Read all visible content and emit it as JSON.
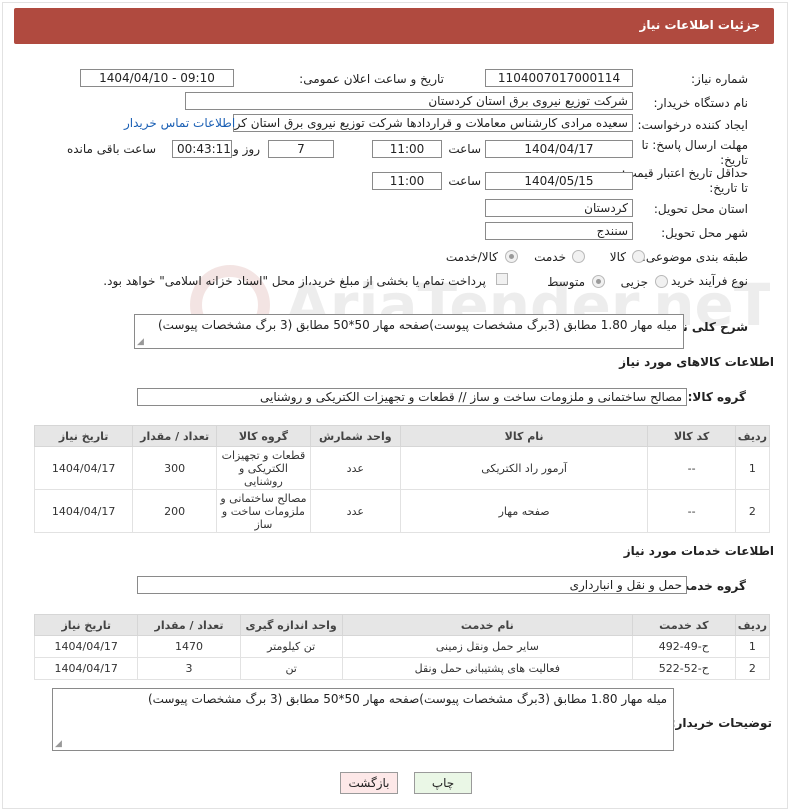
{
  "header": {
    "title": "جزئیات اطلاعات نیاز"
  },
  "fields": {
    "need_number_label": "شماره نیاز:",
    "need_number": "1104007017000114",
    "announce_label": "تاریخ و ساعت اعلان عمومی:",
    "announce_value": "1404/04/10 - 09:10",
    "buyer_org_label": "نام دستگاه خریدار:",
    "buyer_org": "شرکت توزیع نیروی برق استان کردستان",
    "requester_label": "ایجاد کننده درخواست:",
    "requester": "سعیده مرادی کارشناس معاملات و قراردادها شرکت توزیع نیروی برق استان کردستان",
    "contact_link": "اطلاعات تماس خریدار",
    "reply_deadline_label": "مهلت ارسال پاسخ: تا تاریخ:",
    "reply_date": "1404/04/17",
    "time_label": "ساعت",
    "reply_time": "11:00",
    "days_value": "7",
    "days_label": "روز و",
    "remaining_time": "00:43:11",
    "remaining_label": "ساعت باقی مانده",
    "price_validity_label": "حداقل تاریخ اعتبار قیمت: تا تاریخ:",
    "price_date": "1404/05/15",
    "price_time": "11:00",
    "province_label": "استان محل تحویل:",
    "province": "کردستان",
    "city_label": "شهر محل تحویل:",
    "city": "سنندج",
    "category_label": "طبقه بندی موضوعی:",
    "category_options": [
      "کالا",
      "خدمت",
      "کالا/خدمت"
    ],
    "process_label": "نوع فرآیند خرید :",
    "process_options": [
      "جزیی",
      "متوسط"
    ],
    "payment_note": "پرداخت تمام یا بخشی از مبلغ خرید،از محل \"اسناد خزانه اسلامی\" خواهد بود.",
    "description_label": "شرح کلی نیاز:",
    "description": "میله مهار 1.80 مطابق (3برگ مشخصات پیوست)صفحه مهار 50*50 مطابق (3 برگ مشخصات پیوست)"
  },
  "goods": {
    "section_title": "اطلاعات کالاهای مورد نیاز",
    "group_label": "گروه کالا:",
    "group_value": "مصالح ساختمانی و ملزومات ساخت و ساز // قطعات و تجهیزات الکتریکی و روشنایی",
    "columns": [
      "ردیف",
      "کد کالا",
      "نام کالا",
      "واحد شمارش",
      "گروه کالا",
      "تعداد / مقدار",
      "تاریخ نیاز"
    ],
    "rows": [
      [
        "1",
        "--",
        "آرمور راد الکتریکی",
        "عدد",
        "قطعات و تجهیزات الکتریکی و روشنایی",
        "300",
        "1404/04/17"
      ],
      [
        "2",
        "--",
        "صفحه مهار",
        "عدد",
        "مصالح ساختمانی و ملزومات ساخت و ساز",
        "200",
        "1404/04/17"
      ]
    ]
  },
  "services": {
    "section_title": "اطلاعات خدمات مورد نیاز",
    "group_label": "گروه خدمت:",
    "group_value": "حمل و نقل و انبارداری",
    "columns": [
      "ردیف",
      "کد خدمت",
      "نام خدمت",
      "واحد اندازه گیری",
      "تعداد / مقدار",
      "تاریخ نیاز"
    ],
    "rows": [
      [
        "1",
        "ح-49-492",
        "سایر حمل ونقل زمینی",
        "تن کیلومتر",
        "1470",
        "1404/04/17"
      ],
      [
        "2",
        "ح-52-522",
        "فعالیت های پشتیبانی حمل ونقل",
        "تن",
        "3",
        "1404/04/17"
      ]
    ]
  },
  "buyer_notes": {
    "label": "توضیحات خریدار:",
    "value": "میله مهار 1.80 مطابق (3برگ مشخصات پیوست)صفحه مهار 50*50 مطابق (3 برگ مشخصات پیوست)"
  },
  "buttons": {
    "print": "چاپ",
    "back": "بازگشت"
  },
  "watermark": {
    "text": "AriaTender.neT"
  },
  "colors": {
    "header_bg": "#b04a3f",
    "link": "#1a5fb4",
    "print_bg": "#eaf7e6",
    "back_bg": "#fde8e8"
  }
}
